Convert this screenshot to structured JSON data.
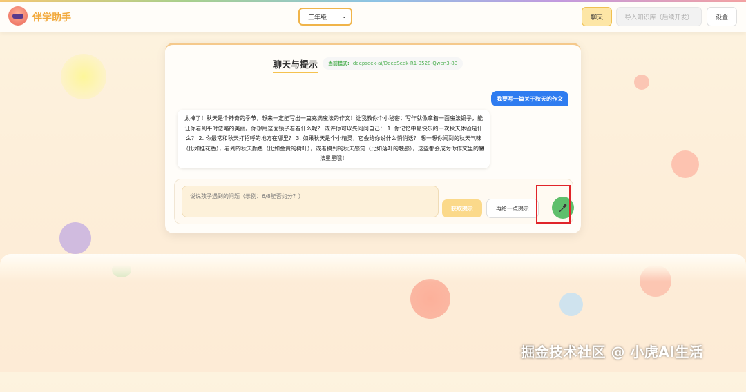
{
  "header": {
    "brand": "伴学助手",
    "grade_select": {
      "value": "三年级"
    },
    "chat_button": "聊天",
    "import_button": "导入知识库（后续开发）",
    "settings_button": "设置"
  },
  "card": {
    "title": "聊天与提示",
    "model_label": "当前模式:",
    "model_value": "deepseek-ai/DeepSeek-R1-0528-Qwen3-8B",
    "user_message": "我要写一篇关于秋天的作文",
    "ai_message": "太棒了！秋天是个神奇的季节，想来一定能写出一篇充满魔法的作文！让我教你个小秘密：写作就像拿着一面魔法镜子，能让你看到平时忽略的美丽。你想用这面镜子看看什么呢？ 或许你可以先问问自己： 1. 你记忆中最快乐的一次秋天体验是什么？ 2. 你最常和秋天打招呼的地方在哪里？ 3. 如果秋天是个小精灵，它会给你说什么悄悄话？ 想一想你闻到的秋天气味（比如桂花香），看到的秋天颜色（比如金黄的树叶），或者摸到的秋天感觉（比如落叶的触感），这些都会成为你作文里的魔法星星哦！",
    "input_placeholder": "说说孩子遇到的问题（示例：6/8能否约分？）",
    "hint_button": "获取提示",
    "more_hint_button": "再给一点提示"
  },
  "icons": {
    "avatar": "robot-avatar-icon",
    "mic": "microphone-icon",
    "select": "chevron-down-icon"
  },
  "colors": {
    "accent": "#f2a93b",
    "user_bubble": "#2f7cf0",
    "mic_button": "#5fbf6c",
    "highlight": "#e0242a"
  },
  "watermark": "掘金技术社区 @ 小虎AI生活"
}
